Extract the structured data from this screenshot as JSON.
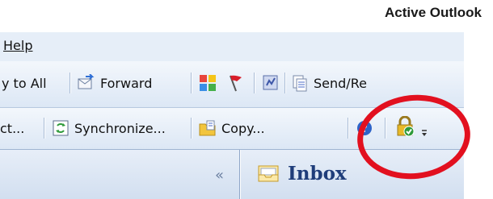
{
  "caption": "Active Outlook",
  "menubar": {
    "help": "Help"
  },
  "toolbar1": {
    "reply_all": "y to All",
    "forward": "Forward",
    "send_receive": "Send/Re"
  },
  "toolbar2": {
    "prev_item": "ct...",
    "synchronize": "Synchronize...",
    "copy": "Copy..."
  },
  "nav": {
    "collapse": "«",
    "inbox": "Inbox"
  },
  "colors": {
    "annotation_circle": "#e2101f",
    "menubar_bg": "#e6eef8",
    "inbox_text": "#1f3d7a"
  },
  "icons": [
    "forward-icon",
    "categories-icon",
    "flag-icon",
    "send-receive-icon",
    "synchronize-icon",
    "copy-icon",
    "help-icon",
    "security-icon",
    "toolbar-options-icon",
    "inbox-folder-icon"
  ]
}
